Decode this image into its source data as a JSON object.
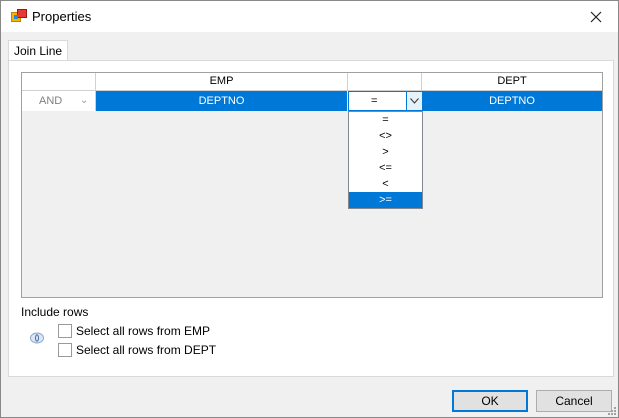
{
  "window": {
    "title": "Properties"
  },
  "tabs": [
    {
      "label": "Join Line"
    }
  ],
  "grid": {
    "headers": {
      "left": "EMP",
      "right": "DEPT"
    },
    "row": {
      "connector": "AND",
      "left_column": "DEPTNO",
      "operator": "=",
      "right_column": "DEPTNO"
    }
  },
  "operator_options": [
    "=",
    "<>",
    ">",
    "<=",
    "<",
    ">="
  ],
  "operator_highlighted": ">=",
  "include_rows": {
    "label": "Include rows",
    "options": [
      {
        "label": "Select all rows from EMP",
        "checked": false
      },
      {
        "label": "Select all rows from DEPT",
        "checked": false
      }
    ]
  },
  "buttons": {
    "ok": "OK",
    "cancel": "Cancel"
  },
  "colors": {
    "selection": "#0078d7",
    "window_bg": "#f0f0f0"
  },
  "icons": {
    "app": "properties-app-icon",
    "close": "close-icon",
    "dropdown": "chevron-down-icon",
    "join": "join-type-icon"
  }
}
